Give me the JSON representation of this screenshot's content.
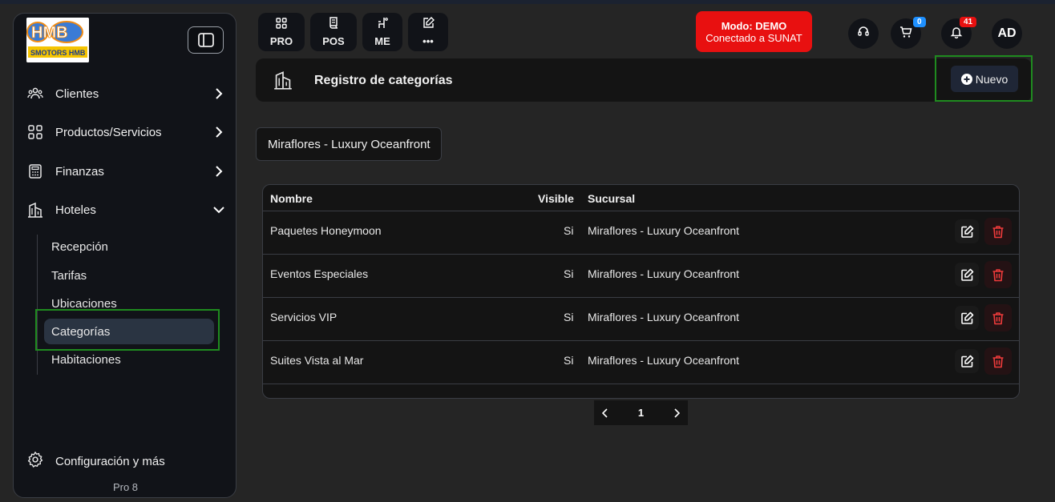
{
  "app": {
    "logo_text_top": "HMB",
    "logo_text_bottom": "SMOTORS HMB"
  },
  "sidebar": {
    "items": [
      {
        "label": "Clientes",
        "icon": "users-icon"
      },
      {
        "label": "Productos/Servicios",
        "icon": "grid-icon"
      },
      {
        "label": "Finanzas",
        "icon": "calculator-icon"
      },
      {
        "label": "Hoteles",
        "icon": "building-icon"
      }
    ],
    "sub_items": [
      {
        "label": "Recepción"
      },
      {
        "label": "Tarifas"
      },
      {
        "label": "Ubicaciones"
      },
      {
        "label": "Categorías",
        "active": true
      },
      {
        "label": "Habitaciones"
      }
    ],
    "config_label": "Configuración y más",
    "version": "Pro 8"
  },
  "toolbar": {
    "buttons": [
      {
        "label": "PRO",
        "icon": "grid-icon"
      },
      {
        "label": "POS",
        "icon": "receipt-icon"
      },
      {
        "label": "ME",
        "icon": "chair-icon"
      },
      {
        "label": "•••",
        "icon": "edit-icon"
      }
    ],
    "demo_title": "Modo: DEMO",
    "demo_subtitle": "Conectado a SUNAT",
    "cart_count": "0",
    "notification_count": "41",
    "avatar_initials": "AD",
    "colors": {
      "demo": "#e81010",
      "cart_badge": "#1e90ff",
      "notif_badge": "#e81010"
    }
  },
  "header": {
    "title": "Registro de categorías",
    "new_button_label": "Nuevo"
  },
  "branch_select": {
    "value": "Miraflores - Luxury Oceanfront"
  },
  "table": {
    "columns": [
      "Nombre",
      "Visible",
      "Sucursal"
    ],
    "rows": [
      {
        "nombre": "Paquetes Honeymoon",
        "visible": "Si",
        "sucursal": "Miraflores - Luxury Oceanfront"
      },
      {
        "nombre": "Eventos Especiales",
        "visible": "Si",
        "sucursal": "Miraflores - Luxury Oceanfront"
      },
      {
        "nombre": "Servicios VIP",
        "visible": "Si",
        "sucursal": "Miraflores - Luxury Oceanfront"
      },
      {
        "nombre": "Suites Vista al Mar",
        "visible": "Si",
        "sucursal": "Miraflores - Luxury Oceanfront"
      }
    ]
  },
  "pagination": {
    "current_page": "1"
  }
}
